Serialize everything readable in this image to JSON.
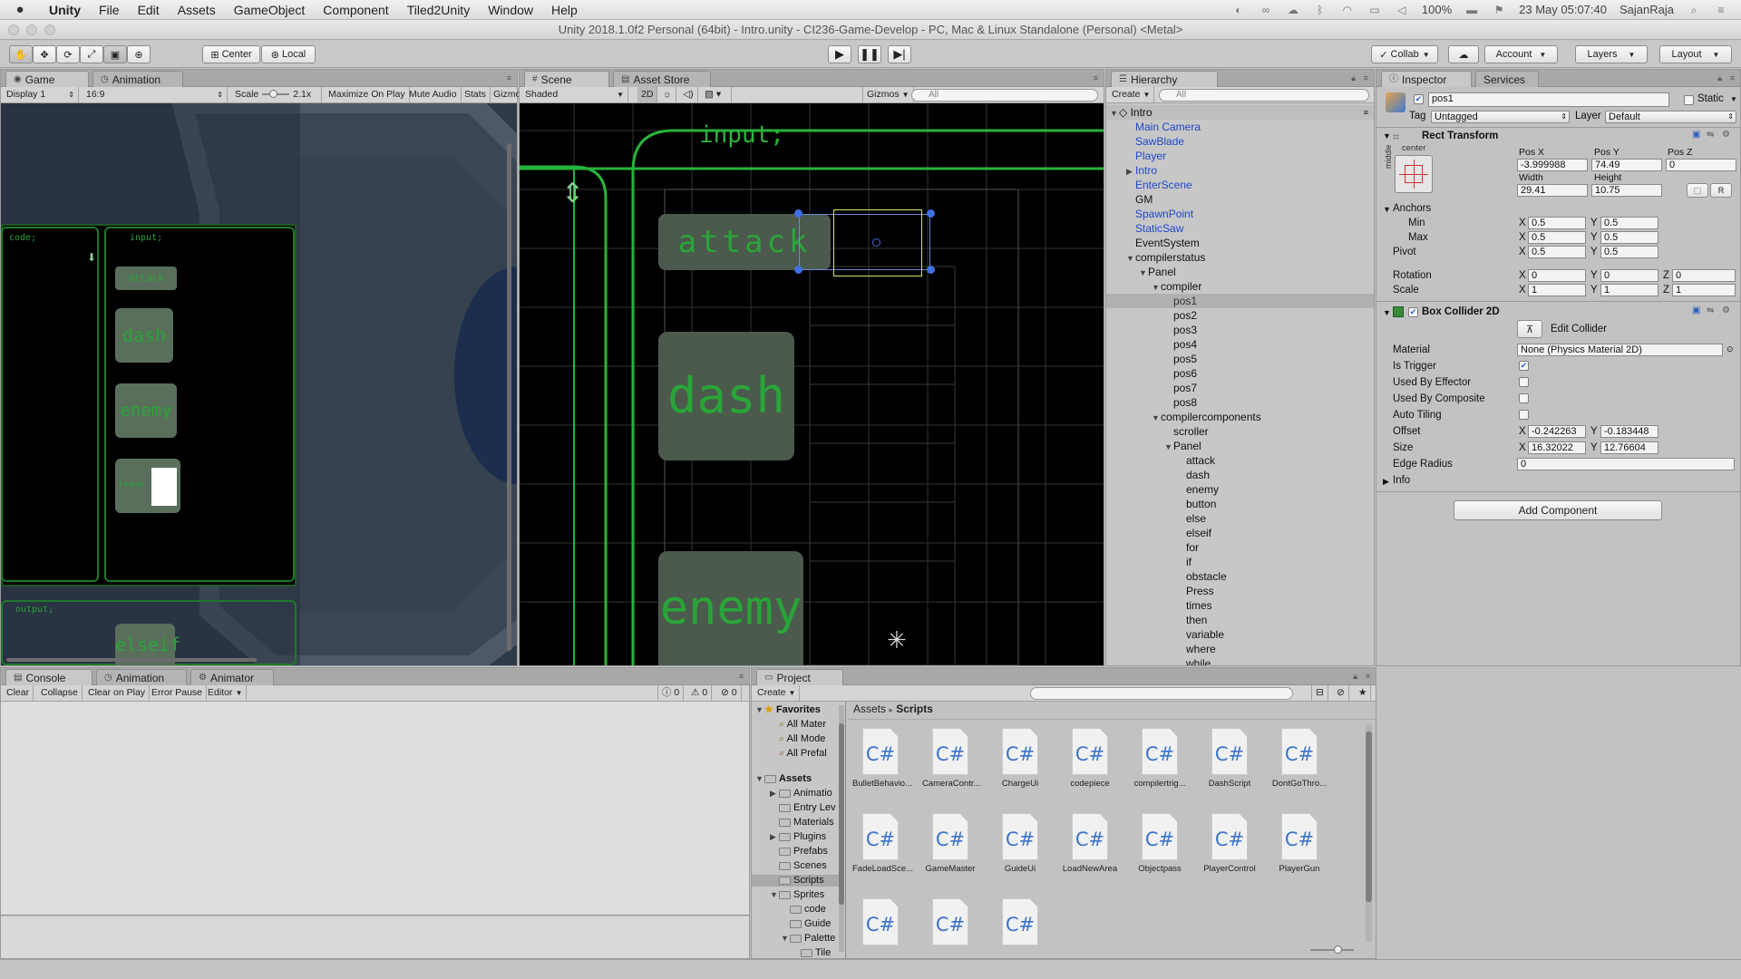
{
  "menubar": {
    "app": "Unity",
    "items": [
      "File",
      "Edit",
      "Assets",
      "GameObject",
      "Component",
      "Tiled2Unity",
      "Window",
      "Help"
    ],
    "battery": "100%",
    "datetime": "23 May  05:07:40",
    "user": "SajanRaja"
  },
  "window_title": "Unity 2018.1.0f2 Personal (64bit) - Intro.unity - CI236-Game-Develop - PC, Mac & Linux Standalone (Personal) <Metal>",
  "toolbar": {
    "center": "Center",
    "local": "Local",
    "collab": "Collab",
    "account": "Account",
    "layers": "Layers",
    "layout": "Layout"
  },
  "game": {
    "tab_game": "Game",
    "tab_animation": "Animation",
    "display": "Display 1",
    "aspect": "16:9",
    "scale_label": "Scale",
    "scale_value": "2.1x",
    "maximize": "Maximize On Play",
    "mute": "Mute Audio",
    "stats": "Stats",
    "gizmos": "Gizmo",
    "code_label": "code;",
    "input_label": "input;",
    "output_label": "output;",
    "tiles": [
      "attack",
      "dash",
      "enemy",
      "leave",
      "elseif"
    ]
  },
  "scene": {
    "tab_scene": "Scene",
    "tab_store": "Asset Store",
    "shaded": "Shaded",
    "mode2d": "2D",
    "gizmos": "Gizmos",
    "search_placeholder": "All",
    "input_label": "input;",
    "tiles": [
      "attack",
      "dash",
      "enemy"
    ]
  },
  "hierarchy": {
    "tab": "Hierarchy",
    "create": "Create",
    "search_placeholder": "All",
    "scene_name": "Intro",
    "rows": [
      {
        "label": "Main Camera",
        "depth": 1,
        "blue": true
      },
      {
        "label": "SawBlade",
        "depth": 1,
        "blue": true
      },
      {
        "label": "Player",
        "depth": 1,
        "blue": true
      },
      {
        "label": "Intro",
        "depth": 1,
        "blue": true,
        "arrow": "▶"
      },
      {
        "label": "EnterScene",
        "depth": 1,
        "blue": true
      },
      {
        "label": "GM",
        "depth": 1
      },
      {
        "label": "SpawnPoint",
        "depth": 1,
        "blue": true
      },
      {
        "label": "StaticSaw",
        "depth": 1,
        "blue": true
      },
      {
        "label": "EventSystem",
        "depth": 1
      },
      {
        "label": "compilerstatus",
        "depth": 1,
        "arrow": "▼"
      },
      {
        "label": "Panel",
        "depth": 2,
        "arrow": "▼"
      },
      {
        "label": "compiler",
        "depth": 3,
        "arrow": "▼"
      },
      {
        "label": "pos1",
        "depth": 4,
        "selected": true
      },
      {
        "label": "pos2",
        "depth": 4
      },
      {
        "label": "pos3",
        "depth": 4
      },
      {
        "label": "pos4",
        "depth": 4
      },
      {
        "label": "pos5",
        "depth": 4
      },
      {
        "label": "pos6",
        "depth": 4
      },
      {
        "label": "pos7",
        "depth": 4
      },
      {
        "label": "pos8",
        "depth": 4
      },
      {
        "label": "compilercomponents",
        "depth": 3,
        "arrow": "▼"
      },
      {
        "label": "scroller",
        "depth": 4
      },
      {
        "label": "Panel",
        "depth": 4,
        "arrow": "▼"
      },
      {
        "label": "attack",
        "depth": 5
      },
      {
        "label": "dash",
        "depth": 5
      },
      {
        "label": "enemy",
        "depth": 5
      },
      {
        "label": "button",
        "depth": 5
      },
      {
        "label": "else",
        "depth": 5
      },
      {
        "label": "elseif",
        "depth": 5
      },
      {
        "label": "for",
        "depth": 5
      },
      {
        "label": "if",
        "depth": 5
      },
      {
        "label": "obstacle",
        "depth": 5
      },
      {
        "label": "Press",
        "depth": 5
      },
      {
        "label": "times",
        "depth": 5
      },
      {
        "label": "then",
        "depth": 5
      },
      {
        "label": "variable",
        "depth": 5
      },
      {
        "label": "where",
        "depth": 5
      },
      {
        "label": "while",
        "depth": 5
      }
    ]
  },
  "inspector": {
    "tab_inspector": "Inspector",
    "tab_services": "Services",
    "object_name": "pos1",
    "static_label": "Static",
    "tag_label": "Tag",
    "tag_value": "Untagged",
    "layer_label": "Layer",
    "layer_value": "Default",
    "rect_transform": {
      "title": "Rect Transform",
      "anchor_h": "center",
      "anchor_v": "middle",
      "posx_label": "Pos X",
      "posx": "-3.999988",
      "posy_label": "Pos Y",
      "posy": "74.49",
      "posz_label": "Pos Z",
      "posz": "0",
      "width_label": "Width",
      "width": "29.41",
      "height_label": "Height",
      "height": "10.75",
      "r_button": "R",
      "anchors_label": "Anchors",
      "min_label": "Min",
      "min_x": "0.5",
      "min_y": "0.5",
      "max_label": "Max",
      "max_x": "0.5",
      "max_y": "0.5",
      "pivot_label": "Pivot",
      "pivot_x": "0.5",
      "pivot_y": "0.5",
      "rotation_label": "Rotation",
      "rot_x": "0",
      "rot_y": "0",
      "rot_z": "0",
      "scale_label": "Scale",
      "scale_x": "1",
      "scale_y": "1",
      "scale_z": "1"
    },
    "box_collider": {
      "title": "Box Collider 2D",
      "edit_collider": "Edit Collider",
      "material_label": "Material",
      "material_value": "None (Physics Material 2D)",
      "is_trigger_label": "Is Trigger",
      "is_trigger": true,
      "used_by_effector_label": "Used By Effector",
      "used_by_composite_label": "Used By Composite",
      "auto_tiling_label": "Auto Tiling",
      "offset_label": "Offset",
      "offset_x": "-0.242263",
      "offset_y": "-0.183448",
      "size_label": "Size",
      "size_x": "16.32022",
      "size_y": "12.76604",
      "edge_radius_label": "Edge Radius",
      "edge_radius": "0",
      "info_label": "Info"
    },
    "add_component": "Add Component"
  },
  "console": {
    "tab_console": "Console",
    "tab_animation": "Animation",
    "tab_animator": "Animator",
    "clear": "Clear",
    "collapse": "Collapse",
    "clear_on_play": "Clear on Play",
    "error_pause": "Error Pause",
    "editor": "Editor",
    "count_info": "0",
    "count_warn": "0",
    "count_error": "0"
  },
  "project": {
    "tab": "Project",
    "create": "Create",
    "breadcrumb_root": "Assets",
    "breadcrumb_sep": "▸",
    "breadcrumb_leaf": "Scripts",
    "favorites_label": "Favorites",
    "favorites": [
      "All Mater",
      "All Mode",
      "All Prefal"
    ],
    "assets_label": "Assets",
    "folders": [
      {
        "label": "Animatio",
        "depth": 1,
        "arrow": "▶"
      },
      {
        "label": "Entry Lev",
        "depth": 1
      },
      {
        "label": "Materials",
        "depth": 1
      },
      {
        "label": "Plugins",
        "depth": 1,
        "arrow": "▶"
      },
      {
        "label": "Prefabs",
        "depth": 1
      },
      {
        "label": "Scenes",
        "depth": 1
      },
      {
        "label": "Scripts",
        "depth": 1,
        "selected": true
      },
      {
        "label": "Sprites",
        "depth": 1,
        "arrow": "▼"
      },
      {
        "label": "code",
        "depth": 2
      },
      {
        "label": "Guide",
        "depth": 2
      },
      {
        "label": "Palette",
        "depth": 2,
        "arrow": "▼"
      },
      {
        "label": "Tile",
        "depth": 3
      }
    ],
    "scripts": [
      "BulletBehavio...",
      "CameraContr...",
      "ChargeUi",
      "codepiece",
      "compilertrig...",
      "DashScript",
      "DontGoThro...",
      "FadeLoadSce...",
      "GameMaster",
      "GuideUi",
      "LoadNewArea",
      "Objectpass",
      "PlayerControl",
      "PlayerGun",
      "",
      "",
      ""
    ],
    "cs_glyph": "C#"
  }
}
